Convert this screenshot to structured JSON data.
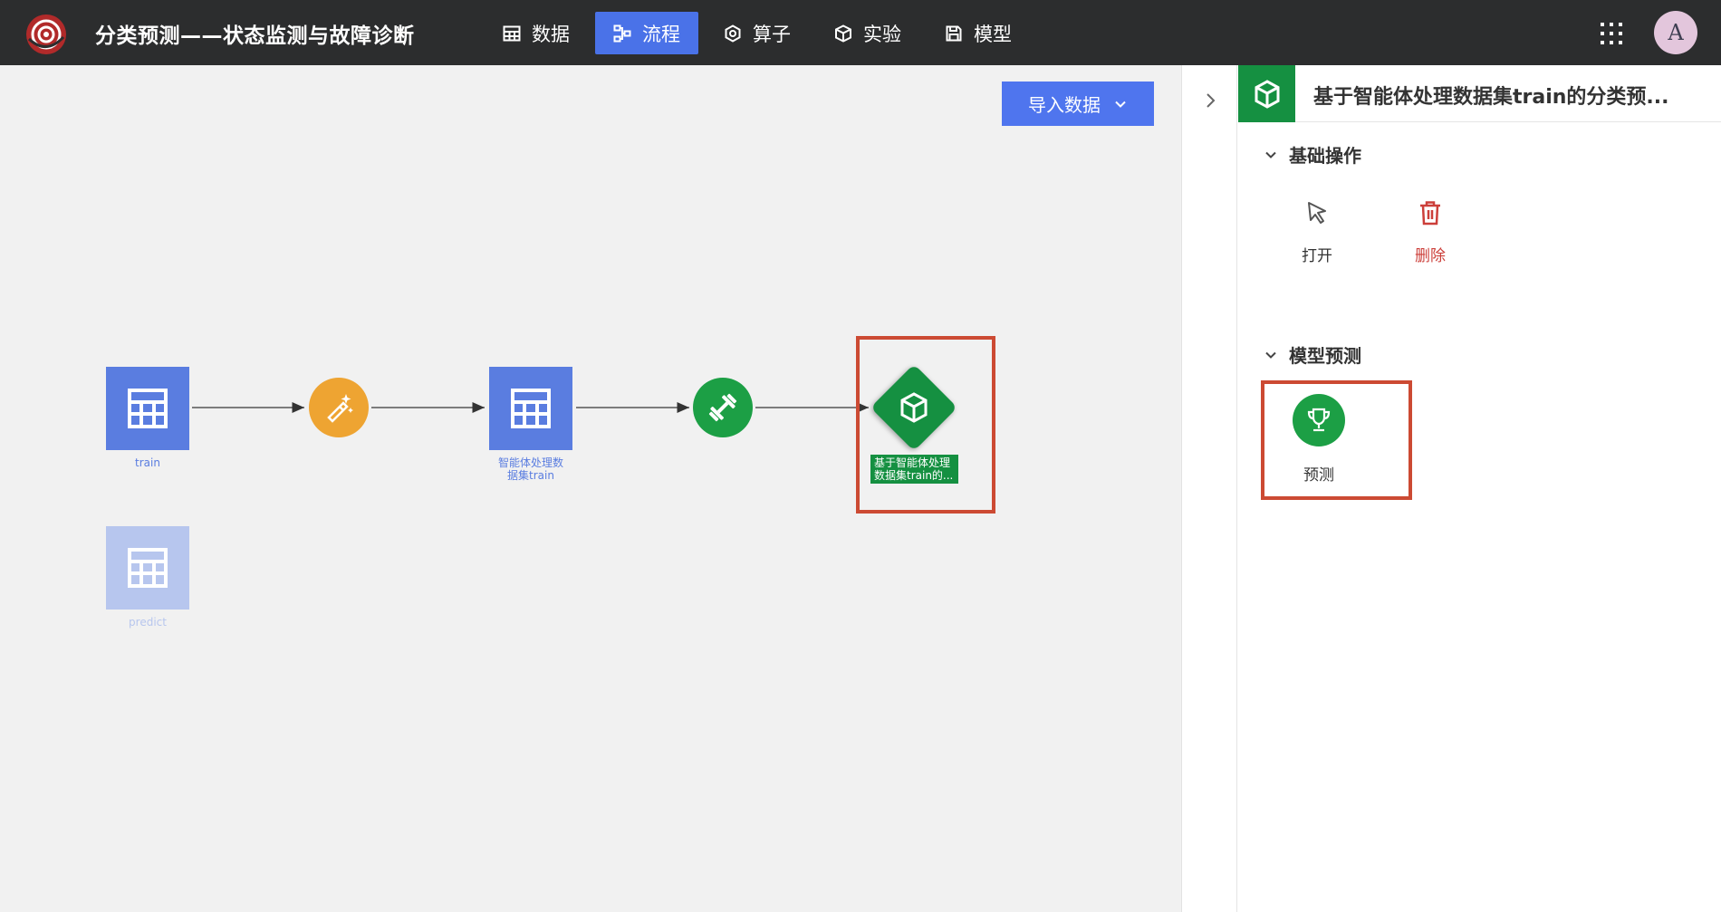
{
  "app": {
    "title": "分类预测——状态监测与故障诊断",
    "avatar_letter": "A"
  },
  "nav": [
    {
      "label": "数据",
      "icon": "table-icon",
      "active": false
    },
    {
      "label": "流程",
      "icon": "flow-icon",
      "active": true
    },
    {
      "label": "算子",
      "icon": "hexagon-icon",
      "active": false
    },
    {
      "label": "实验",
      "icon": "cube-icon",
      "active": false
    },
    {
      "label": "模型",
      "icon": "save-icon",
      "active": false
    }
  ],
  "canvas": {
    "import_label": "导入数据",
    "nodes": [
      {
        "name": "train",
        "label": "train",
        "kind": "table-icon"
      },
      {
        "name": "preprocess",
        "label": "",
        "kind": "magic-wand-icon"
      },
      {
        "name": "processed-dataset",
        "label_line1": "智能体处理数",
        "label_line2": "据集train",
        "kind": "table-icon"
      },
      {
        "name": "train-op",
        "label": "",
        "kind": "dumbbell-icon"
      },
      {
        "name": "model",
        "label_line1": "基于智能体处理",
        "label_line2": "数据集train的...",
        "kind": "cube-icon"
      },
      {
        "name": "predict",
        "label": "predict",
        "kind": "table-icon",
        "faded": true
      }
    ]
  },
  "panel": {
    "title": "基于智能体处理数据集train的分类预...",
    "section_basic": "基础操作",
    "open_label": "打开",
    "delete_label": "删除",
    "section_model": "模型预测",
    "predict_label": "预测"
  },
  "colors": {
    "accent": "#4a72e8",
    "green": "#159041",
    "orange": "#eea432",
    "highlight": "#cc4a33",
    "delete": "#cc3f3a"
  }
}
